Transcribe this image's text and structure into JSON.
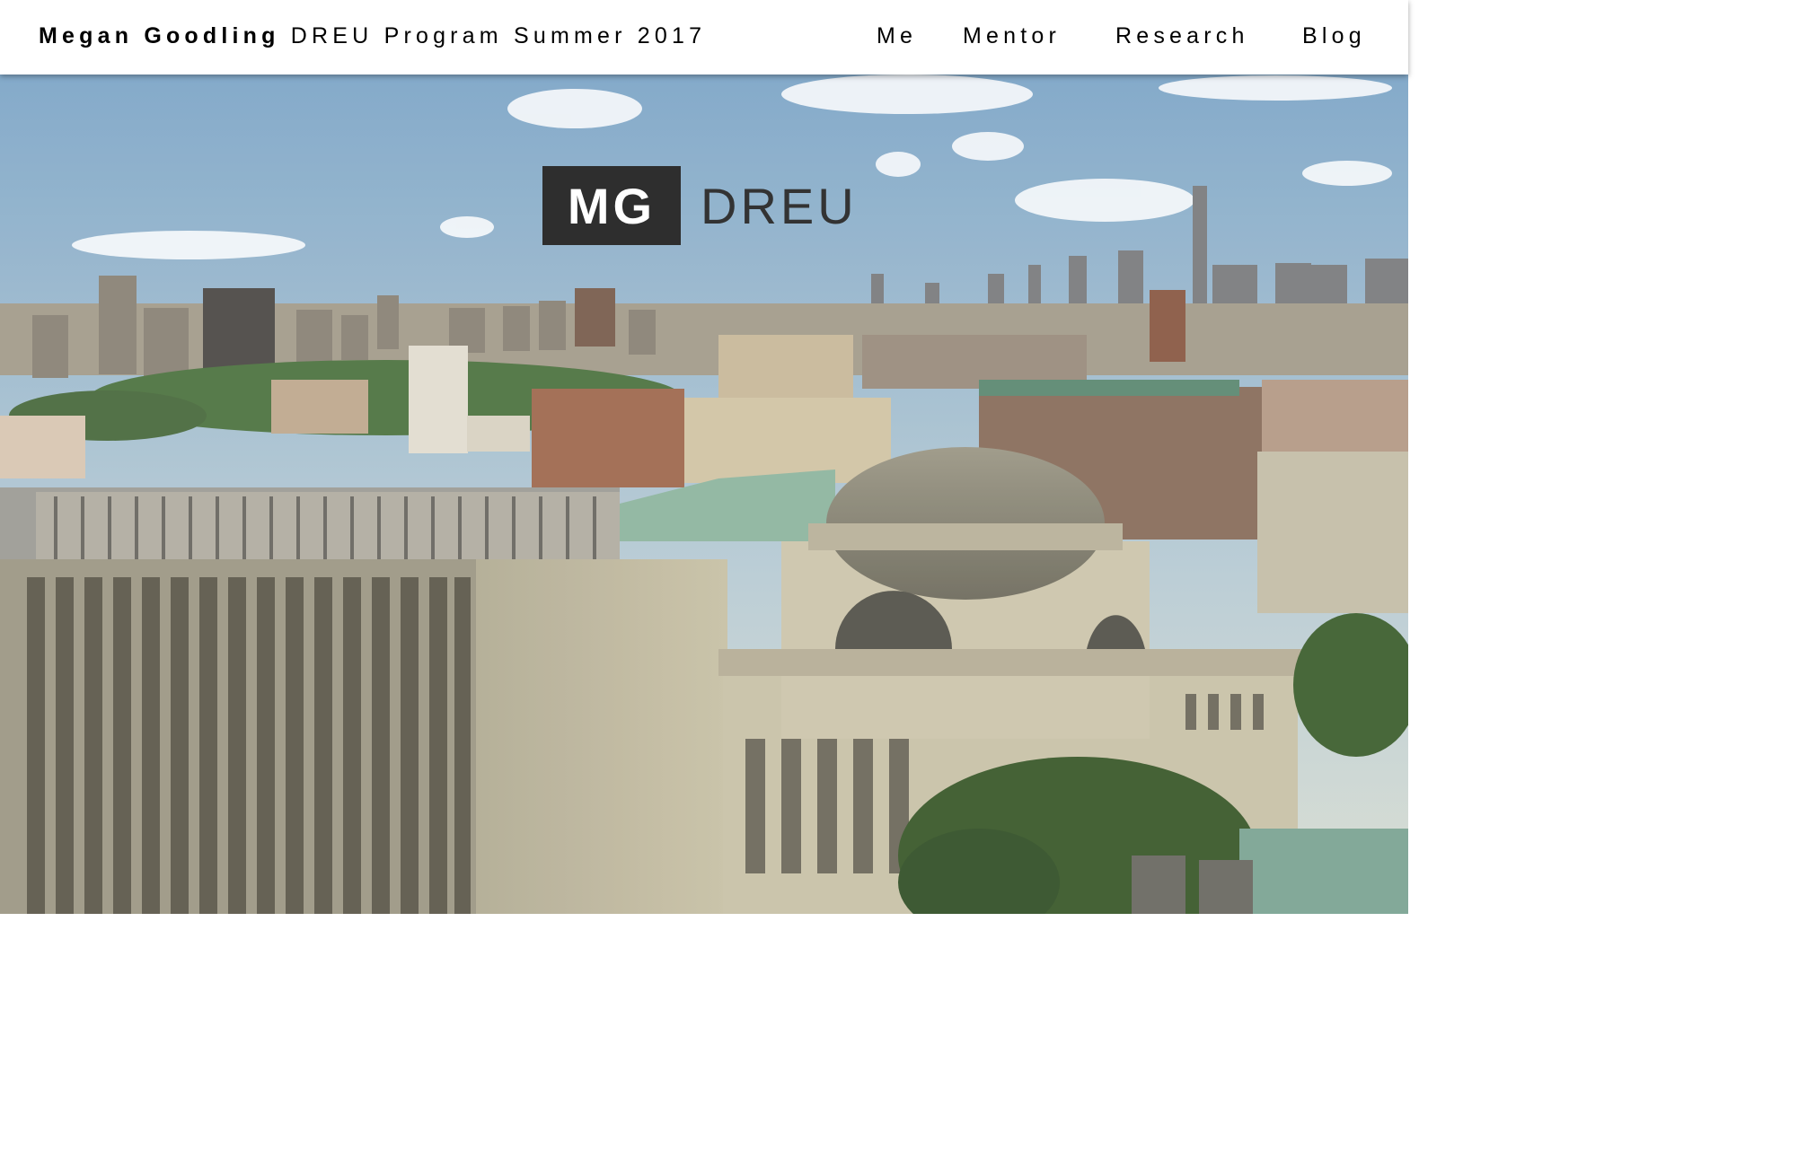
{
  "header": {
    "author": "Megan Goodling",
    "program": "DREU Program Summer 2017"
  },
  "nav": [
    {
      "label": "Me"
    },
    {
      "label": "Mentor"
    },
    {
      "label": "Research"
    },
    {
      "label": "Blog"
    }
  ],
  "hero": {
    "logo_initials": "MG",
    "logo_text": "DREU",
    "image_description_icon": "city-skyline-photo"
  },
  "colors": {
    "sky_top": "#7fa8cc",
    "sky_bottom": "#d6dfd8",
    "logo_box": "#2e2e2e",
    "logo_text": "#333333"
  }
}
